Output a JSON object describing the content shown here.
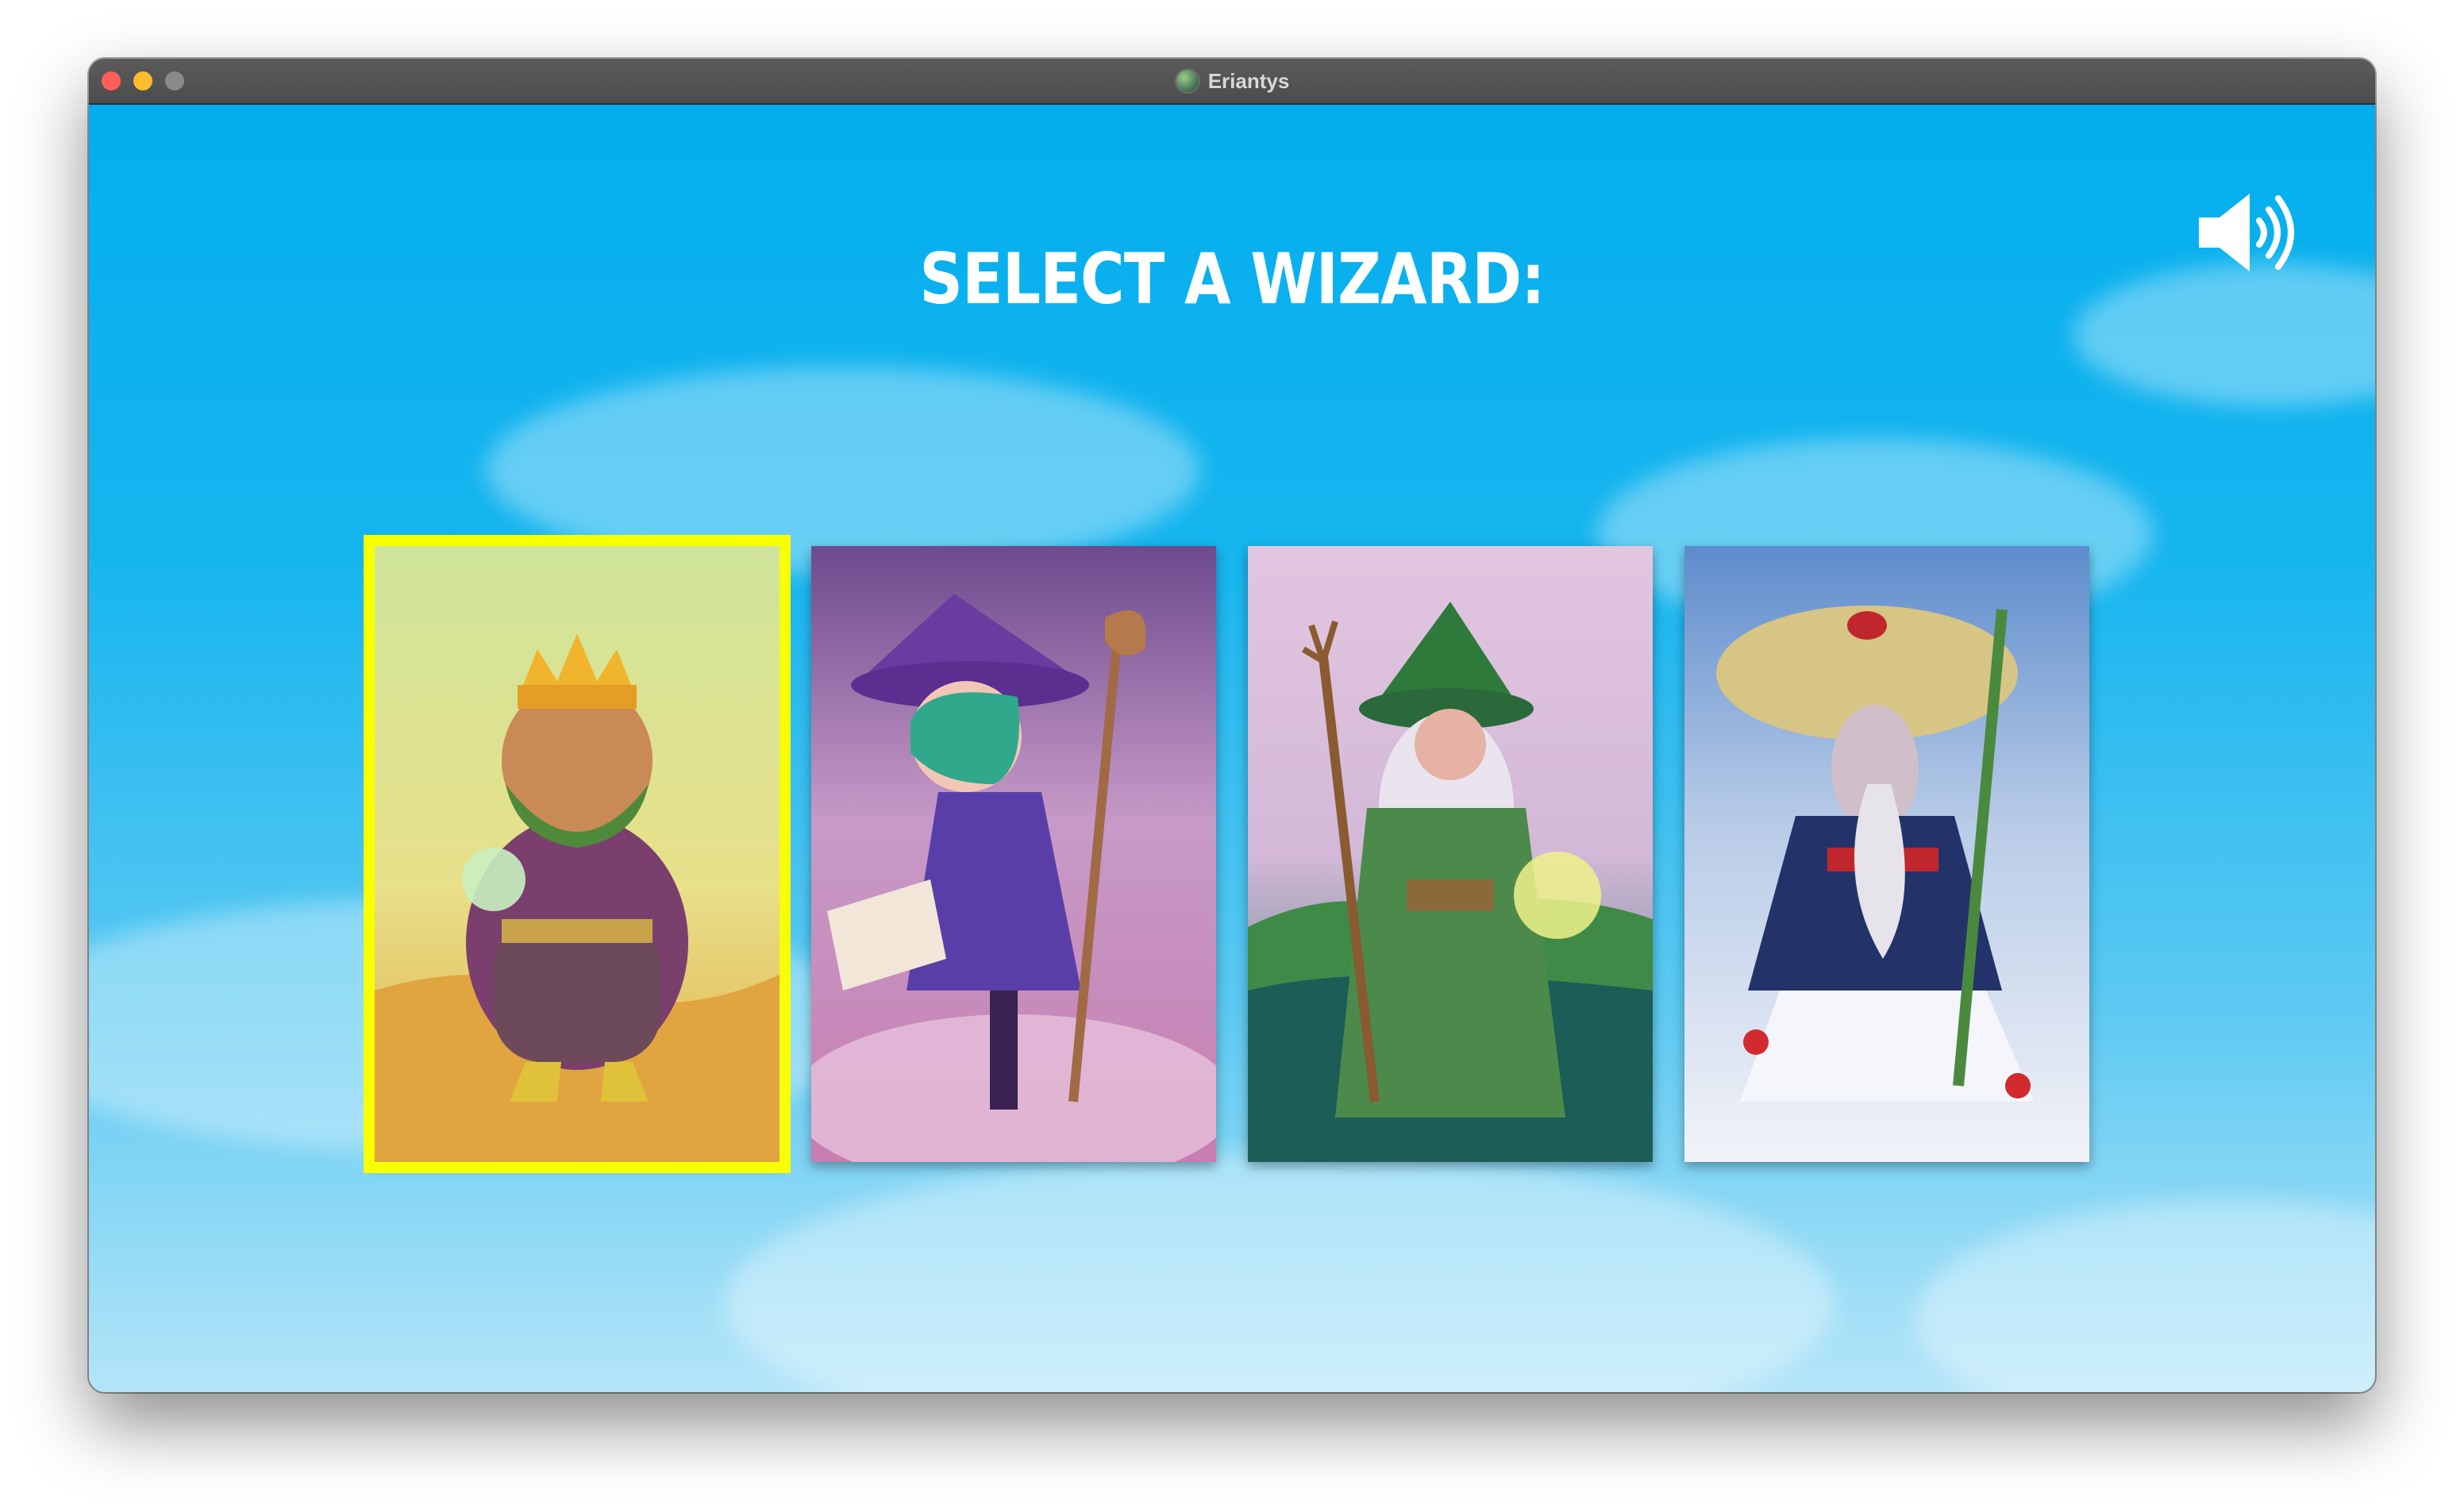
{
  "window": {
    "title": "Eriantys"
  },
  "screen": {
    "heading": "SELECT A WIZARD:",
    "sound_icon": "speaker-volume-icon"
  },
  "wizards": [
    {
      "icon": "desert-king-wizard-card-art",
      "selected": true
    },
    {
      "icon": "witch-wizard-card-art",
      "selected": false
    },
    {
      "icon": "forest-wizard-card-art",
      "selected": false
    },
    {
      "icon": "snow-sage-wizard-card-art",
      "selected": false
    }
  ],
  "colors": {
    "sky_top": "#03aeee",
    "sky_bottom": "#b4e5f8",
    "selection_outline": "#f8ff00",
    "heading": "#ffffff"
  }
}
